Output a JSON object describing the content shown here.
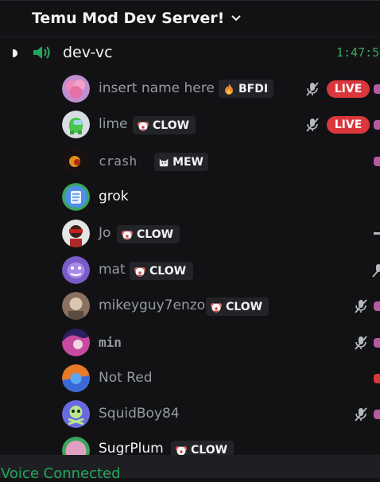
{
  "server": {
    "name": "Temu Mod Dev Server!"
  },
  "channel": {
    "name": "dev-vc",
    "timer": "1:47:5"
  },
  "users": [
    {
      "name": "insert name here",
      "tag": "BFDI",
      "live": "LIVE"
    },
    {
      "name": "lime",
      "tag": "CLOW",
      "live": "LIVE"
    },
    {
      "name": "crash",
      "tag": "MEW"
    },
    {
      "name": "grok"
    },
    {
      "name": "Jo",
      "tag": "CLOW"
    },
    {
      "name": "mat",
      "tag": "CLOW"
    },
    {
      "name": "mikeyguy7enzo",
      "tag": "CLOW"
    },
    {
      "name": "min"
    },
    {
      "name": "Not Red"
    },
    {
      "name": "SquidBoy84"
    },
    {
      "name": "SugrPlum",
      "tag": "CLOW"
    }
  ],
  "voice": {
    "status": "Voice Connected"
  },
  "colors": {
    "accent_green": "#23a55a",
    "live_red": "#da373c",
    "timer_green": "#3ba55c"
  },
  "icons": [
    "chevron-down-icon",
    "speaker-icon",
    "muted-mic-icon",
    "fire-icon",
    "clown-icon",
    "cat-icon"
  ]
}
